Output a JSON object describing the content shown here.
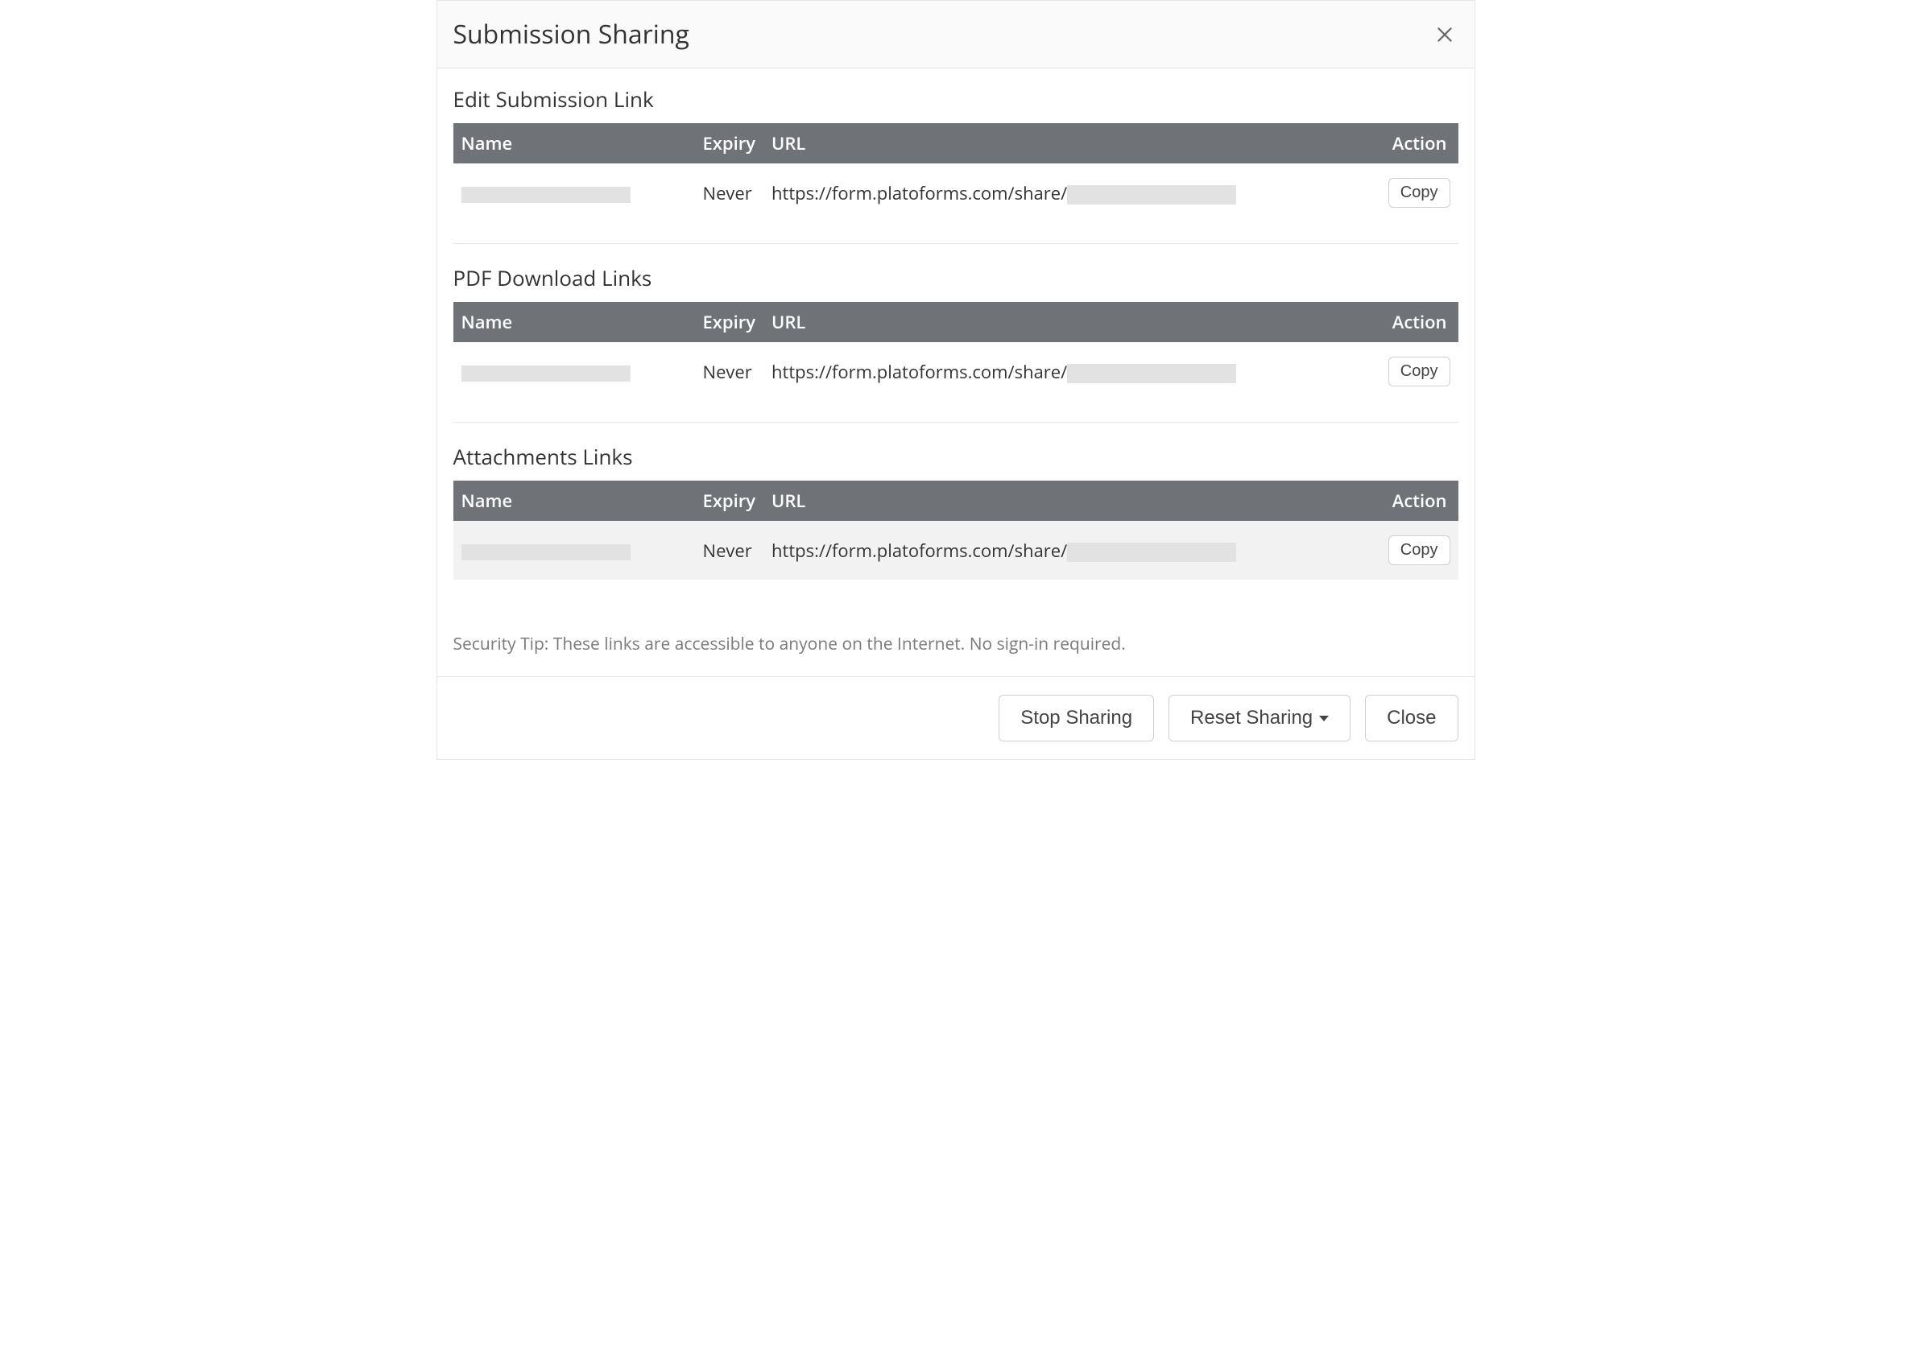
{
  "modal": {
    "title": "Submission Sharing",
    "sections": {
      "edit": {
        "title": "Edit Submission Link",
        "headers": {
          "name": "Name",
          "expiry": "Expiry",
          "url": "URL",
          "action": "Action"
        },
        "rows": [
          {
            "expiry": "Never",
            "url_prefix": "https://form.platoforms.com/share/",
            "action_label": "Copy"
          }
        ]
      },
      "pdf": {
        "title": "PDF Download Links",
        "headers": {
          "name": "Name",
          "expiry": "Expiry",
          "url": "URL",
          "action": "Action"
        },
        "rows": [
          {
            "expiry": "Never",
            "url_prefix": "https://form.platoforms.com/share/",
            "action_label": "Copy"
          }
        ]
      },
      "attachments": {
        "title": "Attachments Links",
        "headers": {
          "name": "Name",
          "expiry": "Expiry",
          "url": "URL",
          "action": "Action"
        },
        "rows": [
          {
            "expiry": "Never",
            "url_prefix": "https://form.platoforms.com/share/",
            "action_label": "Copy"
          }
        ]
      }
    },
    "security_tip": "Security Tip: These links are accessible to anyone on the Internet. No sign-in required.",
    "footer": {
      "stop_sharing": "Stop Sharing",
      "reset_sharing": "Reset Sharing",
      "close": "Close"
    }
  }
}
